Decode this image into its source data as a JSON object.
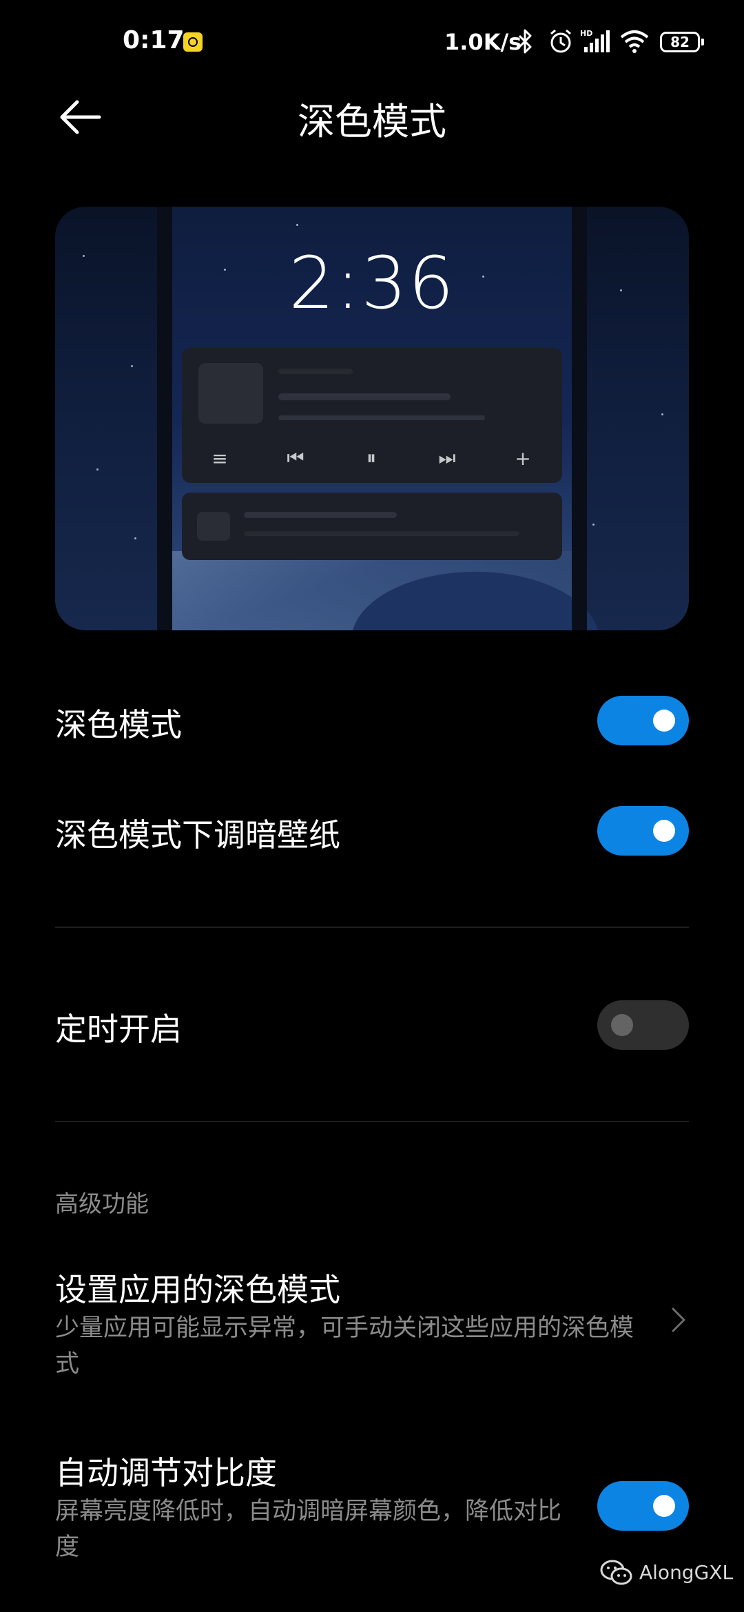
{
  "status_bar": {
    "time": "0:17",
    "network_speed": "1.0K/s",
    "battery_level": "82",
    "icons": [
      "app-notification-icon",
      "bluetooth-icon",
      "alarm-icon",
      "signal-hd-icon",
      "wifi-icon",
      "battery-icon"
    ]
  },
  "header": {
    "title": "深色模式",
    "back_icon": "back-arrow-icon"
  },
  "preview": {
    "clock": "2:36"
  },
  "settings": {
    "dark_mode": {
      "label": "深色模式",
      "enabled": true
    },
    "dim_wallpaper": {
      "label": "深色模式下调暗壁纸",
      "enabled": true
    },
    "scheduled": {
      "label": "定时开启",
      "enabled": false
    },
    "advanced_header": "高级功能",
    "app_dark_mode": {
      "label": "设置应用的深色模式",
      "description": "少量应用可能显示异常，可手动关闭这些应用的深色模式"
    },
    "auto_contrast": {
      "label": "自动调节对比度",
      "description": "屏幕亮度降低时，自动调暗屏幕颜色，降低对比度",
      "enabled": true
    }
  },
  "watermark": {
    "text": "AlongGXL"
  },
  "colors": {
    "accent": "#0c84e4",
    "background": "#000000",
    "secondary_text": "#8b8b8b"
  }
}
